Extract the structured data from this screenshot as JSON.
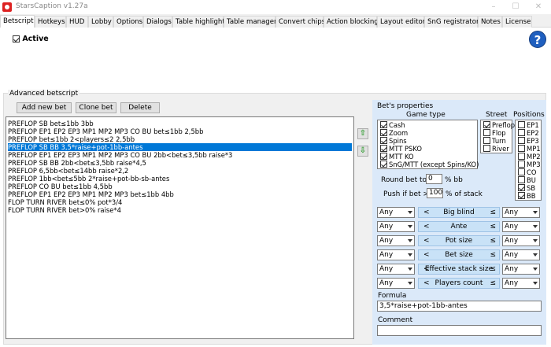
{
  "window": {
    "title": "StarsCaption v1.27a"
  },
  "tabs": [
    {
      "label": "Betscript",
      "active": true
    },
    {
      "label": "Hotkeys"
    },
    {
      "label": "HUD"
    },
    {
      "label": "Lobby"
    },
    {
      "label": "Options"
    },
    {
      "label": "Dialogs"
    },
    {
      "label": "Table highlight"
    },
    {
      "label": "Table manager"
    },
    {
      "label": "Convert chips"
    },
    {
      "label": "Action blocking"
    },
    {
      "label": "Layout editor"
    },
    {
      "label": "SnG registrator"
    },
    {
      "label": "Notes"
    },
    {
      "label": "License"
    }
  ],
  "active_label": "Active",
  "advanced": {
    "label": "Advanced betscript",
    "buttons": {
      "add": "Add new bet",
      "clone": "Clone bet",
      "delete": "Delete"
    },
    "bets": [
      "PREFLOP SB bet≤1bb 3bb",
      "PREFLOP EP1 EP2 EP3 MP1 MP2 MP3 CO BU bet≤1bb 2,5bb",
      "PREFLOP bet≤1bb 2<players≤2 2,5bb",
      "PREFLOP SB BB 3,5*raise+pot-1bb-antes",
      "PREFLOP EP1 EP2 EP3 MP1 MP2 MP3 CO BU 2bb<bet≤3,5bb raise*3",
      "PREFLOP SB BB 2bb<bet≤3,5bb raise*4,5",
      "PREFLOP 6,5bb<bet≤14bb raise*2,2",
      "PREFLOP 1bb<bet≤5bb 2*raise+pot-bb-sb-antes",
      "PREFLOP CO BU bet≤1bb 4,5bb",
      "PREFLOP EP1 EP2 EP3 MP1 MP2 MP3 bet≤1bb 4bb",
      "FLOP TURN RIVER bet≤0% pot*3/4",
      "FLOP TURN RIVER bet>0% raise*4"
    ],
    "selected_index": 3
  },
  "props": {
    "title": "Bet's properties",
    "game_type_label": "Game type",
    "street_label": "Street",
    "positions_label": "Positions",
    "game_types": [
      {
        "label": "Cash",
        "checked": true
      },
      {
        "label": "Zoom",
        "checked": true
      },
      {
        "label": "Spins",
        "checked": true
      },
      {
        "label": "MTT PSKO",
        "checked": true
      },
      {
        "label": "MTT KO",
        "checked": true
      },
      {
        "label": "SnG/MTT (except Spins/KO)",
        "checked": true
      }
    ],
    "streets": [
      {
        "label": "Preflop",
        "checked": true
      },
      {
        "label": "Flop",
        "checked": false
      },
      {
        "label": "Turn",
        "checked": false
      },
      {
        "label": "River",
        "checked": false
      }
    ],
    "positions": [
      {
        "label": "EP1",
        "checked": false
      },
      {
        "label": "EP2",
        "checked": false
      },
      {
        "label": "EP3",
        "checked": false
      },
      {
        "label": "MP1",
        "checked": false
      },
      {
        "label": "MP2",
        "checked": false
      },
      {
        "label": "MP3",
        "checked": false
      },
      {
        "label": "CO",
        "checked": false
      },
      {
        "label": "BU",
        "checked": false
      },
      {
        "label": "SB",
        "checked": true
      },
      {
        "label": "BB",
        "checked": true
      }
    ],
    "round_label": "Round bet to",
    "round_value": "0",
    "round_unit": "% bb",
    "push_label": "Push if bet >",
    "push_value": "100",
    "push_unit": "% of stack",
    "conditions": [
      {
        "left": "Any",
        "name": "Big blind",
        "right": "Any"
      },
      {
        "left": "Any",
        "name": "Ante",
        "right": "Any"
      },
      {
        "left": "Any",
        "name": "Pot size",
        "right": "Any"
      },
      {
        "left": "Any",
        "name": "Bet size",
        "right": "Any"
      },
      {
        "left": "Any",
        "name": "Effective stack size",
        "right": "Any"
      },
      {
        "left": "Any",
        "name": "Players count",
        "right": "Any"
      }
    ],
    "cond_lt": "<",
    "cond_le": "≤",
    "formula_label": "Formula",
    "formula_value": "3,5*raise+pot-1bb-antes",
    "comment_label": "Comment",
    "comment_value": ""
  }
}
